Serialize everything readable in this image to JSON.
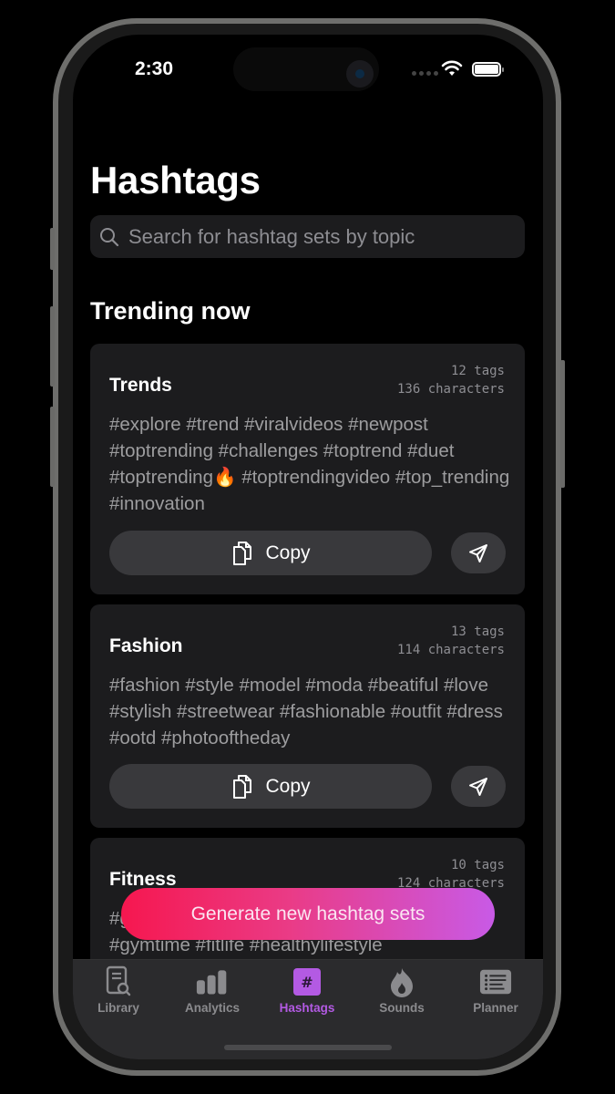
{
  "status_bar": {
    "time": "2:30"
  },
  "header": {
    "title": "Hashtags"
  },
  "search": {
    "placeholder": "Search for hashtag sets by topic",
    "value": ""
  },
  "section": {
    "title": "Trending now"
  },
  "cards": [
    {
      "title": "Trends",
      "tags_count": "12 tags",
      "chars_count": "136 characters",
      "tags": "#explore #trend #viralvideos #newpost #toptrending #challenges #toptrend #duet #toptrending🔥 #toptrendingvideo #top_trending #innovation",
      "copy_label": "Copy"
    },
    {
      "title": "Fashion",
      "tags_count": "13 tags",
      "chars_count": "114 characters",
      "tags": "#fashion #style #model #moda #beatiful #love #stylish #streetwear #fashionable #outfit #dress #ootd #photooftheday",
      "copy_label": "Copy"
    },
    {
      "title": "Fitness",
      "tags_count": "10 tags",
      "chars_count": "124 characters",
      "tags": "#gym #fitness #workout #fitnessmotivation #gymtime #fitlife #healthylifestyle",
      "copy_label": "Copy"
    }
  ],
  "generate_button": {
    "label": "Generate new hashtag sets"
  },
  "tabbar": {
    "active_color": "#b35ae3",
    "items": [
      {
        "label": "Library",
        "icon": "document-search-icon"
      },
      {
        "label": "Analytics",
        "icon": "bar-chart-icon"
      },
      {
        "label": "Hashtags",
        "icon": "hashtag-icon",
        "active": true
      },
      {
        "label": "Sounds",
        "icon": "flame-icon"
      },
      {
        "label": "Planner",
        "icon": "list-icon"
      }
    ]
  }
}
